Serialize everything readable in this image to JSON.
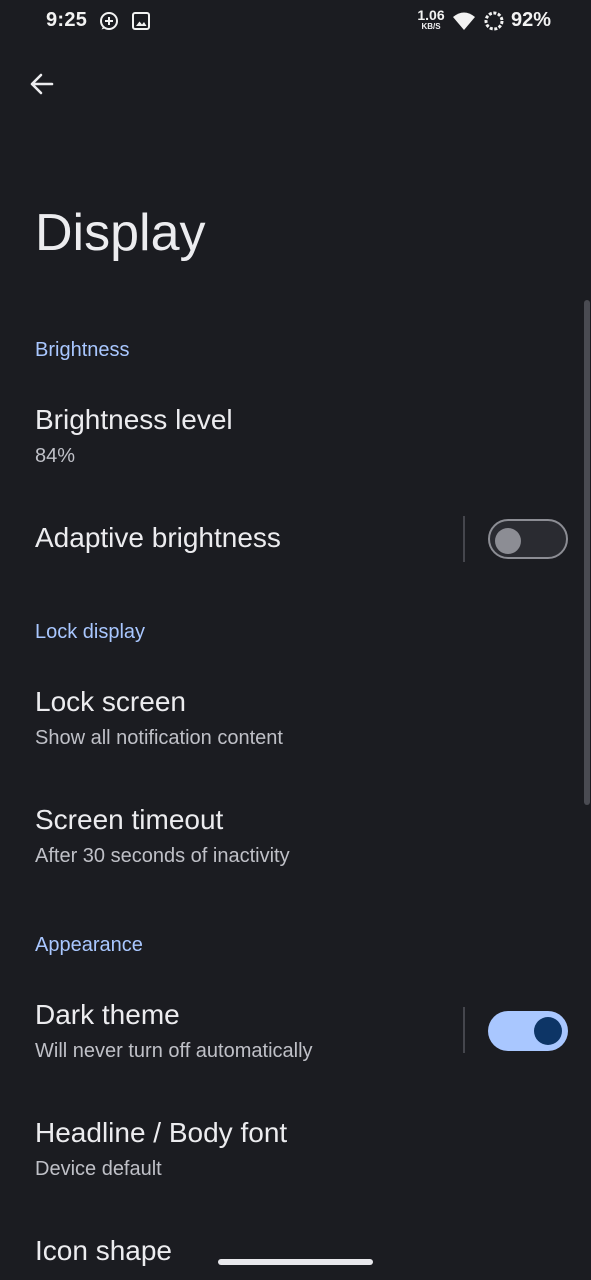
{
  "status_bar": {
    "time": "9:25",
    "icons": [
      "add-circle-notification-icon",
      "image-notification-icon",
      "wifi-icon",
      "battery-saver-ring-icon"
    ],
    "net_speed_value": "1.06",
    "net_speed_unit": "KB/S",
    "battery": "92%"
  },
  "toolbar": {
    "back_icon": "arrow-back-icon"
  },
  "page": {
    "title": "Display"
  },
  "sections": {
    "brightness": {
      "header": "Brightness"
    },
    "lock_display": {
      "header": "Lock display"
    },
    "appearance": {
      "header": "Appearance"
    }
  },
  "items": {
    "brightness_level": {
      "title": "Brightness level",
      "summary": "84%"
    },
    "adaptive_brightness": {
      "title": "Adaptive brightness",
      "enabled": false
    },
    "lock_screen": {
      "title": "Lock screen",
      "summary": "Show all notification content"
    },
    "screen_timeout": {
      "title": "Screen timeout",
      "summary": "After 30 seconds of inactivity"
    },
    "dark_theme": {
      "title": "Dark theme",
      "summary": "Will never turn off automatically",
      "enabled": true
    },
    "font": {
      "title": "Headline / Body font",
      "summary": "Device default"
    },
    "icon_shape": {
      "title": "Icon shape"
    }
  },
  "colors": {
    "background": "#1b1c21",
    "accent": "#a9c7ff",
    "switch_on_knob": "#0d3566",
    "text_primary": "#ececef",
    "text_secondary": "#bfc0c7"
  }
}
